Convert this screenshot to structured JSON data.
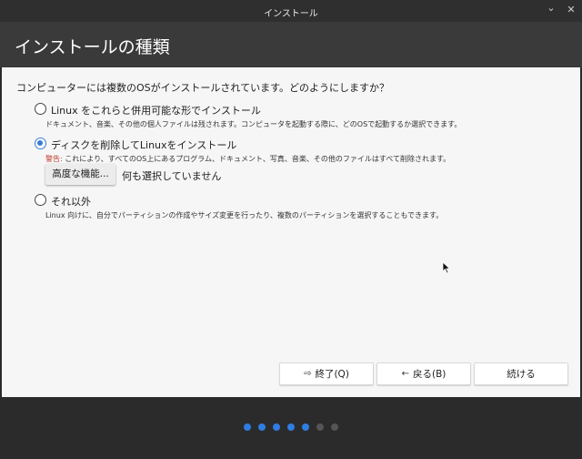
{
  "window": {
    "title": "インストール",
    "minimize_icon": "minimize-icon",
    "close_icon": "close-icon"
  },
  "header": {
    "title": "インストールの種類"
  },
  "question": "コンピューターには複数のOSがインストールされています。どのようにしますか？",
  "options": [
    {
      "label": "Linux をこれらと併用可能な形でインストール",
      "description": "ドキュメント、音楽、その他の個人ファイルは残されます。コンピュータを起動する際に、どのOSで起動するか選択できます。",
      "selected": false
    },
    {
      "label": "ディスクを削除してLinuxをインストール",
      "warning_label": "警告:",
      "description": " これにより、すべてのOS上にあるプログラム、ドキュメント、写真、音楽、その他のファイルはすべて削除されます。",
      "selected": true
    },
    {
      "label": "それ以外",
      "description": "Linux 向けに、自分でパーティションの作成やサイズ変更を行ったり、複数のパーティションを選択することもできます。",
      "selected": false
    }
  ],
  "advanced": {
    "button_label": "高度な機能...",
    "status": "何も選択していません"
  },
  "buttons": {
    "quit_label": "終了(Q)",
    "quit_icon": "exit-icon",
    "back_label": "戻る(B)",
    "back_icon": "arrow-left-icon",
    "continue_label": "続ける"
  },
  "progress": {
    "completed_steps": 5,
    "total_steps": 7
  },
  "colors": {
    "accent": "#3a7bd5",
    "warning": "#c0392b",
    "step_done": "#2f7de1",
    "step_todo": "#555555"
  }
}
